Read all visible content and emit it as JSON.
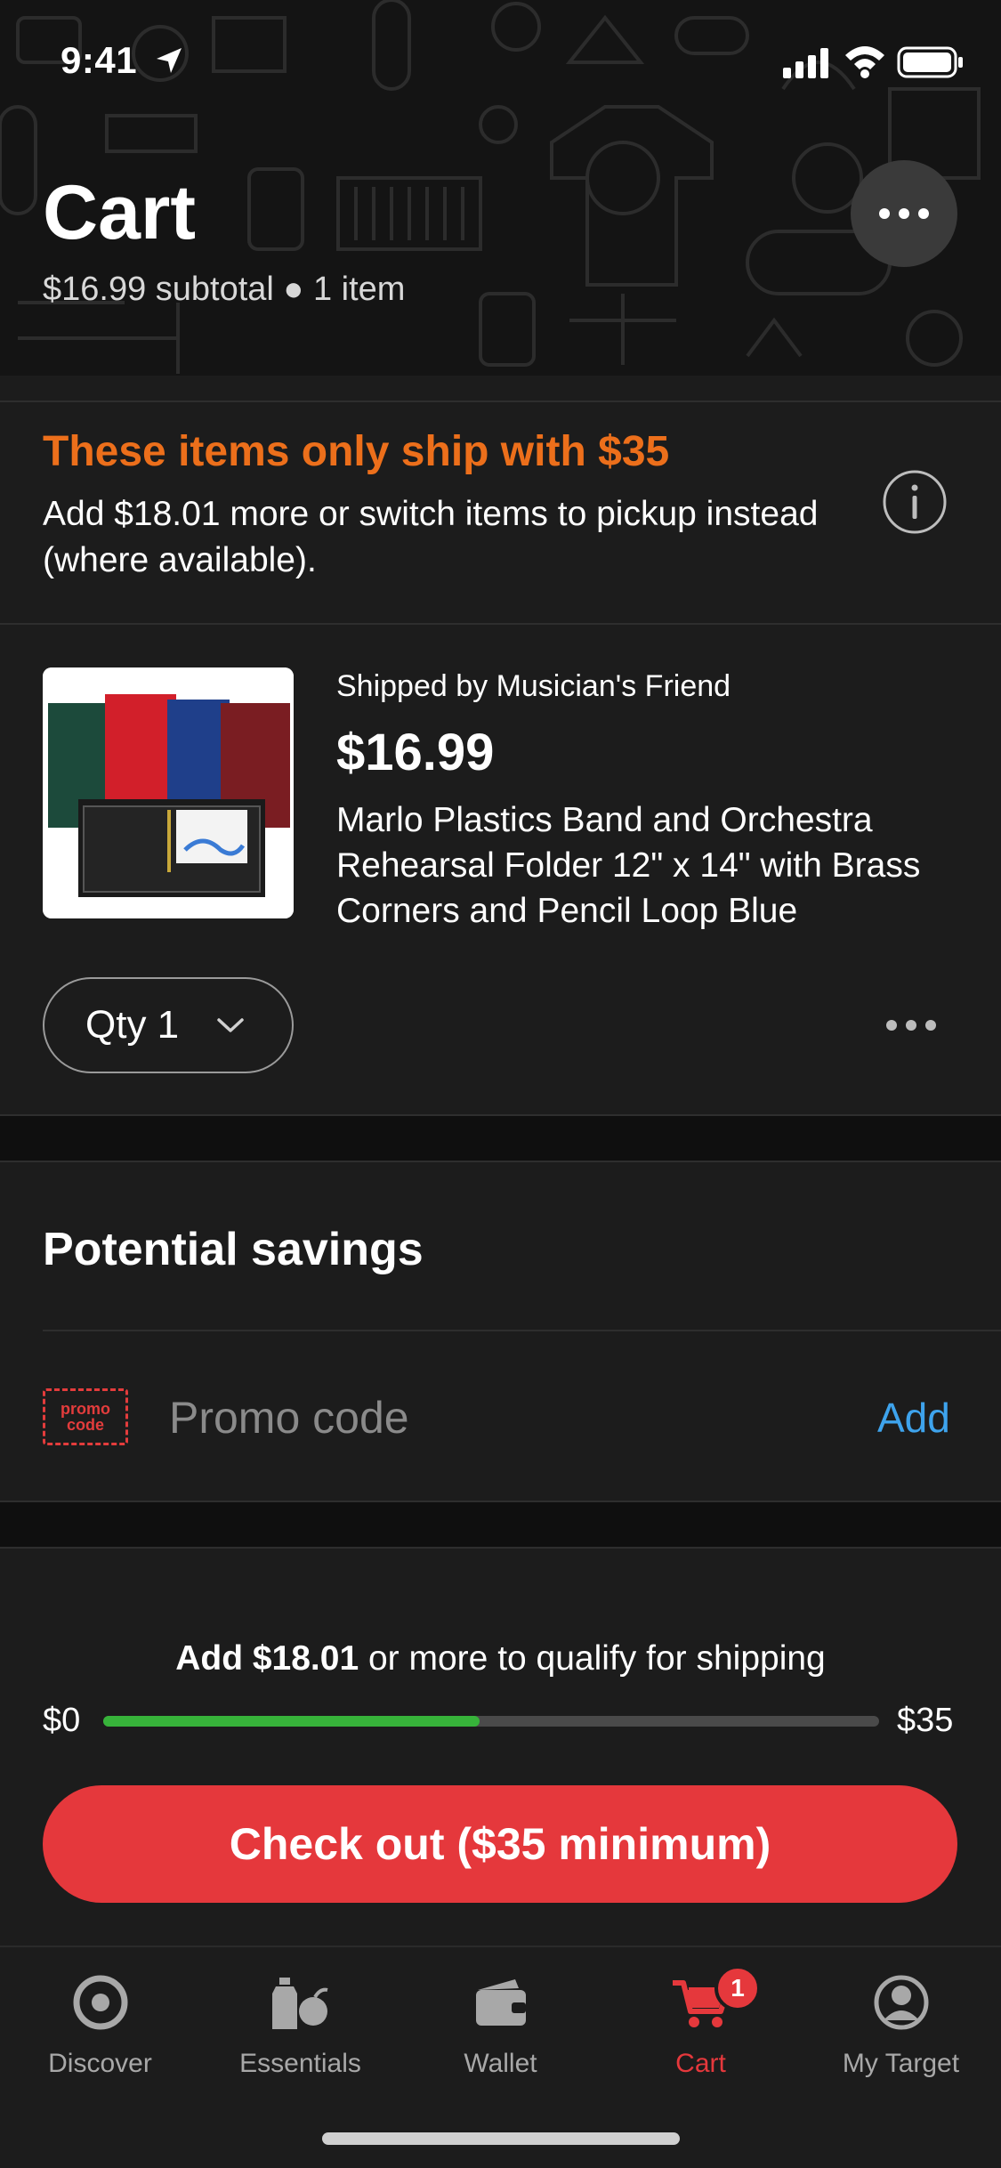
{
  "status_bar": {
    "time": "9:41"
  },
  "header": {
    "title": "Cart",
    "subtitle": "$16.99 subtotal ● 1 item"
  },
  "shipping_notice": {
    "title": "These items only ship with $35",
    "description": "Add $18.01 more or switch items to pickup instead (where available)."
  },
  "product": {
    "seller": "Shipped by Musician's Friend",
    "price": "$16.99",
    "name": "Marlo Plastics Band and Orchestra Rehearsal Folder 12\" x 14\" with Brass Corners and Pencil Loop Blue",
    "quantity_label": "Qty 1"
  },
  "savings": {
    "title": "Potential savings",
    "promo_icon_text_line1": "promo",
    "promo_icon_text_line2": "code",
    "promo_placeholder": "Promo code",
    "promo_value": "",
    "add_label": "Add"
  },
  "shipping_progress": {
    "message_bold": "Add $18.01",
    "message_rest": " or more to qualify for shipping",
    "start_label": "$0",
    "end_label": "$35",
    "progress_fraction": 0.485
  },
  "checkout": {
    "label": "Check out ($35 minimum)"
  },
  "tab_bar": {
    "tabs": [
      {
        "label": "Discover",
        "icon": "discover-icon"
      },
      {
        "label": "Essentials",
        "icon": "essentials-icon"
      },
      {
        "label": "Wallet",
        "icon": "wallet-icon"
      },
      {
        "label": "Cart",
        "icon": "cart-icon",
        "active": true,
        "badge": "1"
      },
      {
        "label": "My Target",
        "icon": "profile-icon"
      }
    ]
  },
  "colors": {
    "accent_red": "#e5383c",
    "warning_orange": "#ec6f1b",
    "link_blue": "#3ea3ec",
    "progress_green": "#37b33a",
    "background": "#1c1c1c"
  }
}
